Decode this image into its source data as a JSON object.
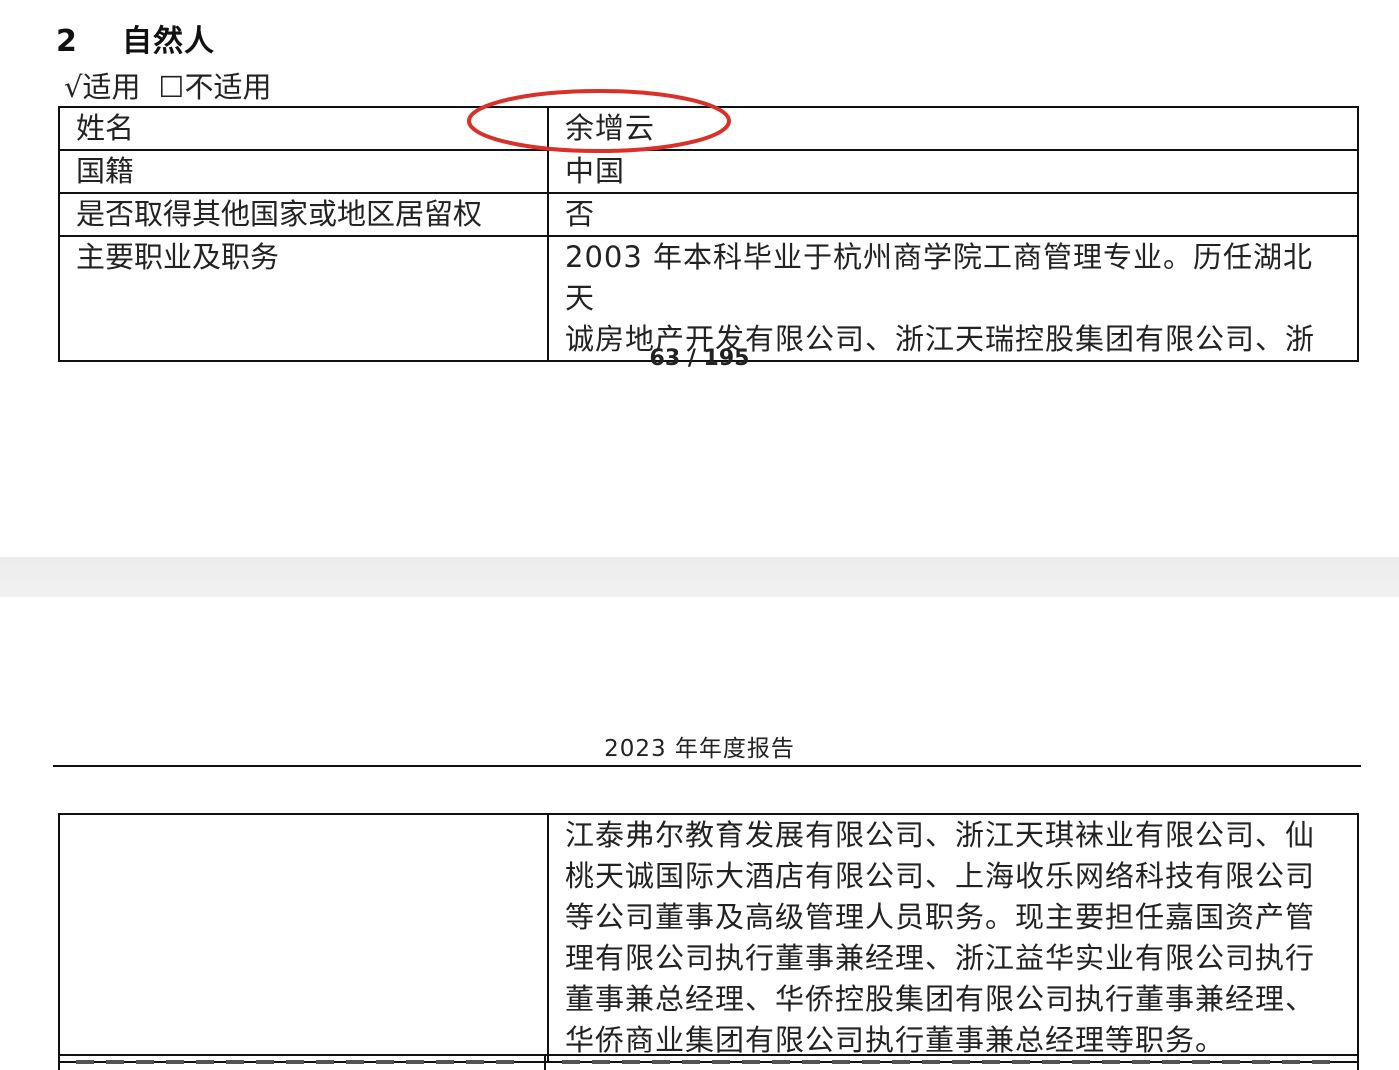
{
  "section": {
    "number": "2",
    "title": "自然人"
  },
  "applicability": {
    "applicable": "√适用",
    "not_applicable": "☐不适用"
  },
  "person_table": [
    {
      "label": "姓名",
      "value": "余增云"
    },
    {
      "label": "国籍",
      "value": "中国"
    },
    {
      "label": "是否取得其他国家或地区居留权",
      "value": "否"
    },
    {
      "label": "主要职业及职务",
      "value_lines": [
        "2003 年本科毕业于杭州商学院工商管理专业。历任湖北天",
        "诚房地产开发有限公司、浙江天瑞控股集团有限公司、浙"
      ]
    }
  ],
  "page_number": "63 / 195",
  "report_header": "2023 年年度报告",
  "continuation": {
    "lines": [
      "江泰弗尔教育发展有限公司、浙江天琪袜业有限公司、仙",
      "桃天诚国际大酒店有限公司、上海收乐网络科技有限公司",
      "等公司董事及高级管理人员职务。现主要担任嘉国资产管",
      "理有限公司执行董事兼经理、浙江益华实业有限公司执行",
      "董事兼总经理、华侨控股集团有限公司执行董事兼经理、",
      "华侨商业集团有限公司执行董事兼总经理等职务。"
    ]
  },
  "colors": {
    "annotation_ellipse": "#d9302a",
    "page_gap": "#eeeeee"
  }
}
